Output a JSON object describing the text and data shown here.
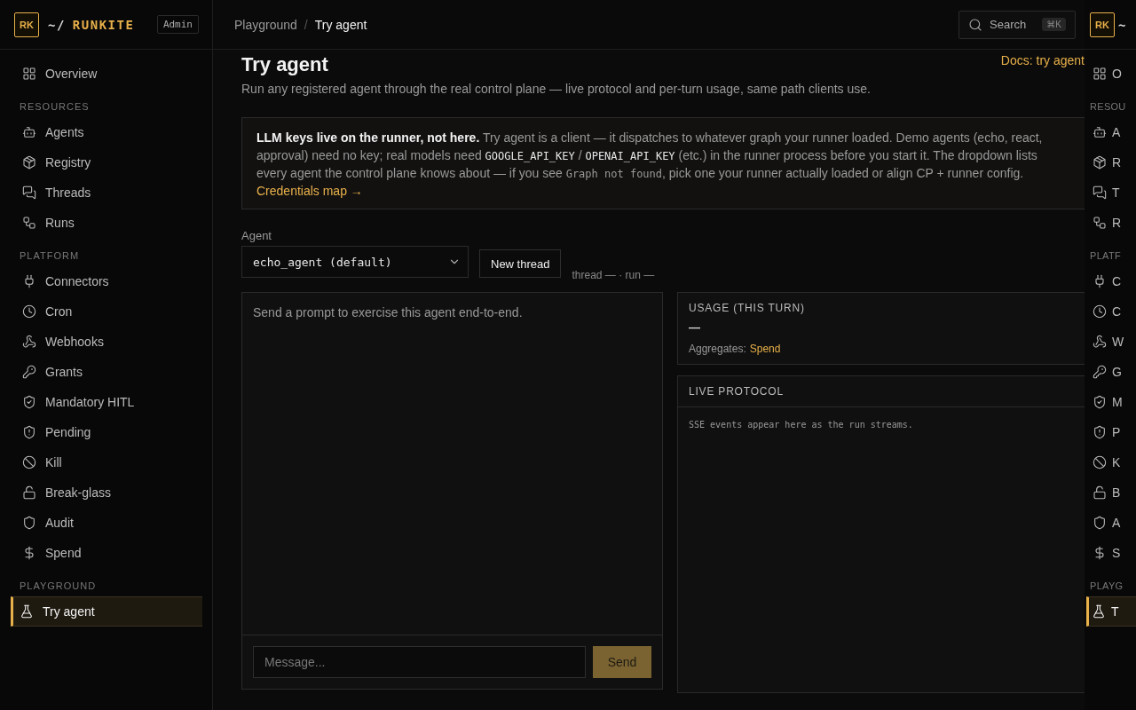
{
  "sidebar": {
    "logo": "RK",
    "prefix": "~/",
    "name": "RUNKITE",
    "role": "Admin",
    "sections": [
      {
        "items": [
          {
            "label": "Overview",
            "selected": false
          }
        ]
      },
      {
        "title": "RESOURCES",
        "items": [
          {
            "label": "Agents",
            "selected": false
          },
          {
            "label": "Registry",
            "selected": false
          },
          {
            "label": "Threads",
            "selected": false
          },
          {
            "label": "Runs",
            "selected": false
          }
        ]
      },
      {
        "title": "PLATFORM",
        "items": [
          {
            "label": "Connectors",
            "selected": false
          },
          {
            "label": "Cron",
            "selected": false
          },
          {
            "label": "Webhooks",
            "selected": false
          },
          {
            "label": "Grants",
            "selected": false
          },
          {
            "label": "Mandatory HITL",
            "selected": false
          },
          {
            "label": "Pending",
            "selected": false
          },
          {
            "label": "Kill",
            "selected": false
          },
          {
            "label": "Break-glass",
            "selected": false
          },
          {
            "label": "Audit",
            "selected": false
          },
          {
            "label": "Spend",
            "selected": false
          }
        ]
      },
      {
        "title": "PLAYGROUND",
        "items": [
          {
            "label": "Try agent",
            "selected": true
          }
        ]
      }
    ]
  },
  "header": {
    "breadcrumbs": [
      "Playground",
      "Try agent"
    ],
    "separator": "/",
    "search": {
      "placeholder": "Search",
      "shortcut": "⌘K"
    }
  },
  "page": {
    "title": "Try agent",
    "docs_link": "Docs: try agent",
    "subtitle": "Run any registered agent through the real control plane — live protocol and per-turn usage, same path clients use.",
    "callout": {
      "segments": [
        {
          "kind": "bold",
          "text": "LLM keys live on the runner, not here."
        },
        {
          "kind": "text",
          "text": " Try agent is a client — it dispatches to whatever graph your runner loaded. Demo agents (echo, react, approval) need no key; real models need "
        },
        {
          "kind": "code",
          "text": "GOOGLE_API_KEY"
        },
        {
          "kind": "text",
          "text": " / "
        },
        {
          "kind": "code",
          "text": "OPENAI_API_KEY"
        },
        {
          "kind": "text",
          "text": " (etc.) in the runner process before you start it. The dropdown lists every agent the control plane knows about — if you see "
        },
        {
          "kind": "dimcode",
          "text": "Graph not found"
        },
        {
          "kind": "text",
          "text": ", pick one your runner actually loaded or align CP + runner config."
        }
      ],
      "link": "Credentials map →"
    },
    "agent_label": "Agent",
    "agent_select": "echo_agent (default)",
    "new_thread": "New thread",
    "thread_info": "thread — · run —",
    "chat": {
      "empty": "Send a prompt to exercise this agent end-to-end.",
      "message_placeholder": "Message...",
      "send": "Send"
    },
    "usage": {
      "title": "USAGE (THIS TURN)",
      "value": "—",
      "aggregates_label": "Aggregates:",
      "aggregates_link": "Spend"
    },
    "protocol": {
      "title": "LIVE PROTOCOL",
      "empty": "SSE events appear here as the run streams."
    }
  },
  "mirror_sidebar": {
    "logo": "RK",
    "prefix": "~",
    "sections": [
      {
        "items": [
          {
            "label": "O",
            "selected": false
          }
        ]
      },
      {
        "title": "RESOU",
        "items": [
          {
            "label": "A",
            "selected": false
          },
          {
            "label": "R",
            "selected": false
          },
          {
            "label": "T",
            "selected": false
          },
          {
            "label": "R",
            "selected": false
          }
        ]
      },
      {
        "title": "PLATF",
        "items": [
          {
            "label": "C",
            "selected": false
          },
          {
            "label": "C",
            "selected": false
          },
          {
            "label": "W",
            "selected": false
          },
          {
            "label": "G",
            "selected": false
          },
          {
            "label": "M",
            "selected": false
          },
          {
            "label": "P",
            "selected": false
          },
          {
            "label": "K",
            "selected": false
          },
          {
            "label": "B",
            "selected": false
          },
          {
            "label": "A",
            "selected": false
          },
          {
            "label": "S",
            "selected": false
          }
        ]
      },
      {
        "title": "PLAYG",
        "items": [
          {
            "label": "T",
            "selected": true
          }
        ]
      }
    ]
  }
}
